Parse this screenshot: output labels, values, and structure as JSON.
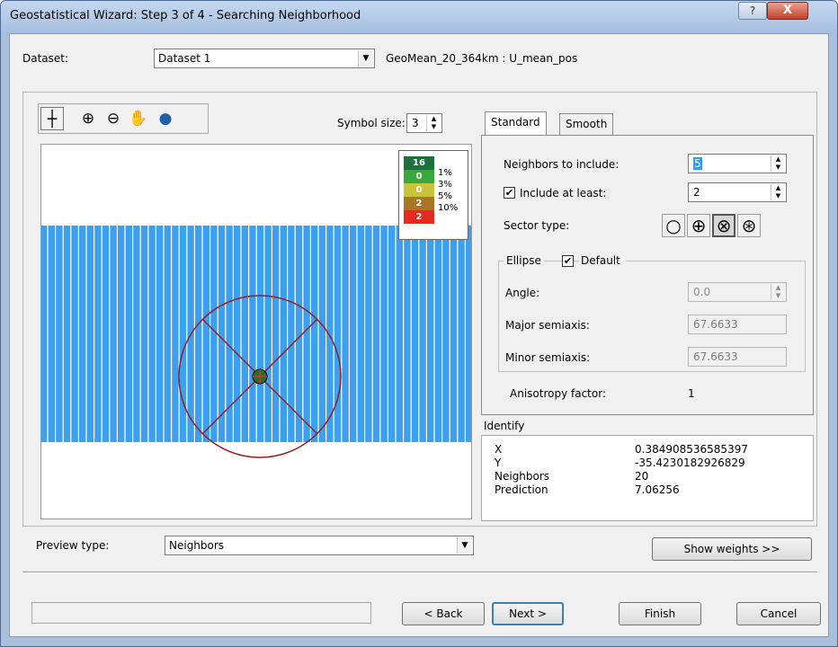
{
  "window": {
    "title": "Geostatistical Wizard: Step 3 of 4 - Searching Neighborhood",
    "help_label": "?",
    "close_label": "X"
  },
  "dataset": {
    "label": "Dataset:",
    "selected": "Dataset 1",
    "field": "GeoMean_20_364km : U_mean_pos"
  },
  "toolbar": {
    "symbol_size_label": "Symbol size:",
    "symbol_size_value": "3"
  },
  "legend": {
    "rows": [
      {
        "value": "16",
        "color": "#1d6f3b"
      },
      {
        "value": "0",
        "color": "#39a83a"
      },
      {
        "value": "0",
        "color": "#c8c43a"
      },
      {
        "value": "2",
        "color": "#a97623"
      },
      {
        "value": "2",
        "color": "#e32b20"
      }
    ],
    "percents": [
      "1%",
      "3%",
      "5%",
      "10%"
    ]
  },
  "colors": {
    "grid_fill": "#3ca0ef",
    "grid_line": "#ffffff",
    "ellipse_stroke": "#9b1d1d",
    "point_fill": "#2d6a2d"
  },
  "tabs": {
    "standard": "Standard",
    "smooth": "Smooth"
  },
  "settings": {
    "neighbors_label": "Neighbors to include:",
    "neighbors_value": "5",
    "include_least_label": "Include at least:",
    "include_least_value": "2",
    "include_least_checked": "✔",
    "sector_type_label": "Sector type:",
    "sector_icons": [
      "○",
      "⊕",
      "⊗",
      "⊛"
    ]
  },
  "ellipse": {
    "group_label": "Ellipse",
    "default_label": "Default",
    "default_checked": "✔",
    "angle_label": "Angle:",
    "angle_value": "0.0",
    "major_label": "Major semiaxis:",
    "major_value": "67.6633",
    "minor_label": "Minor semiaxis:",
    "minor_value": "67.6633",
    "anisotropy_label": "Anisotropy factor:",
    "anisotropy_value": "1"
  },
  "identify": {
    "title": "Identify",
    "rows": [
      {
        "key": "X",
        "value": "0.384908536585397"
      },
      {
        "key": "Y",
        "value": "-35.4230182926829"
      },
      {
        "key": "Neighbors",
        "value": "20"
      },
      {
        "key": "Prediction",
        "value": "7.06256"
      }
    ]
  },
  "preview": {
    "label": "Preview type:",
    "selected": "Neighbors"
  },
  "buttons": {
    "show_weights": "Show weights >>",
    "back": "< Back",
    "next": "Next >",
    "finish": "Finish",
    "cancel": "Cancel"
  }
}
